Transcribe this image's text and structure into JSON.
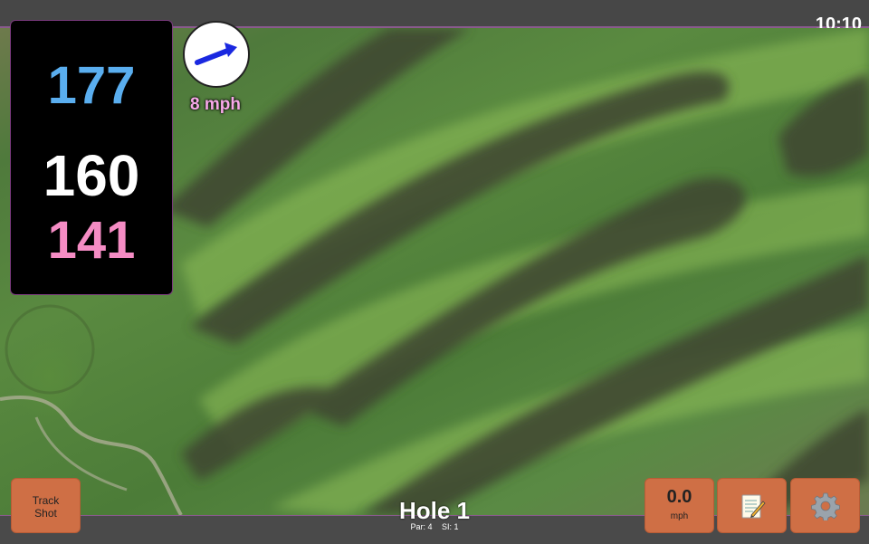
{
  "status_bar": {
    "time": "10:10"
  },
  "distances": {
    "back": "177",
    "center": "160",
    "front": "141"
  },
  "wind": {
    "speed": "8 mph",
    "direction_icon": "arrow-right-icon"
  },
  "buttons": {
    "track_shot_line1": "Track",
    "track_shot_line2": "Shot",
    "speed_value": "0.0",
    "speed_unit": "mph",
    "notes_icon": "notepad-icon",
    "settings_icon": "gear-icon"
  },
  "hole": {
    "title": "Hole 1",
    "par": "Par: 4",
    "si": "SI: 1"
  },
  "colors": {
    "back": "#5aaeef",
    "center": "#ffffff",
    "front": "#f58cc4",
    "button": "#cf6f45",
    "wind_text": "#f7a8e8"
  }
}
